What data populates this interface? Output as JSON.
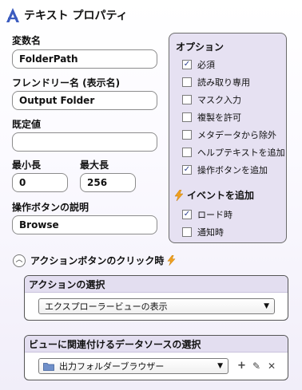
{
  "header": {
    "title": "テキスト プロパティ",
    "logo_icon": "a-logo-icon"
  },
  "fields": {
    "variable_name": {
      "label": "変数名",
      "value": "FolderPath"
    },
    "friendly_name": {
      "label": "フレンドリー名 (表示名)",
      "value": "Output Folder"
    },
    "default_value": {
      "label": "既定値",
      "value": ""
    },
    "min_length": {
      "label": "最小長",
      "value": "0"
    },
    "max_length": {
      "label": "最大長",
      "value": "256"
    },
    "button_description": {
      "label": "操作ボタンの説明",
      "value": "Browse"
    }
  },
  "options": {
    "title": "オプション",
    "items": [
      {
        "label": "必須",
        "checked": true,
        "mark": "✓"
      },
      {
        "label": "読み取り専用",
        "checked": false,
        "mark": ""
      },
      {
        "label": "マスク入力",
        "checked": false,
        "mark": ""
      },
      {
        "label": "複製を許可",
        "checked": false,
        "mark": ""
      },
      {
        "label": "メタデータから除外",
        "checked": false,
        "mark": ""
      },
      {
        "label": "ヘルプテキストを追加",
        "checked": false,
        "mark": ""
      },
      {
        "label": "操作ボタンを追加",
        "checked": true,
        "mark": "✓"
      }
    ],
    "events_title": "イベントを追加",
    "events": [
      {
        "label": "ロード時",
        "checked": true,
        "mark": "✓"
      },
      {
        "label": "通知時",
        "checked": false,
        "mark": ""
      }
    ]
  },
  "action_section": {
    "title": "アクションボタンのクリック時",
    "collapse_glyph": "︿",
    "action_panel": {
      "header": "アクションの選択",
      "selected": "エクスプローラービューの表示"
    },
    "datasource_panel": {
      "header": "ビューに関連付けるデータソースの選択",
      "selected": "出力フォルダーブラウザー"
    },
    "tools": {
      "add": "+",
      "edit": "✎",
      "delete": "✕"
    }
  },
  "colors": {
    "accent": "#3b5bbf",
    "panel_bg": "#e6e1f2",
    "lightning": "#f0a020"
  }
}
